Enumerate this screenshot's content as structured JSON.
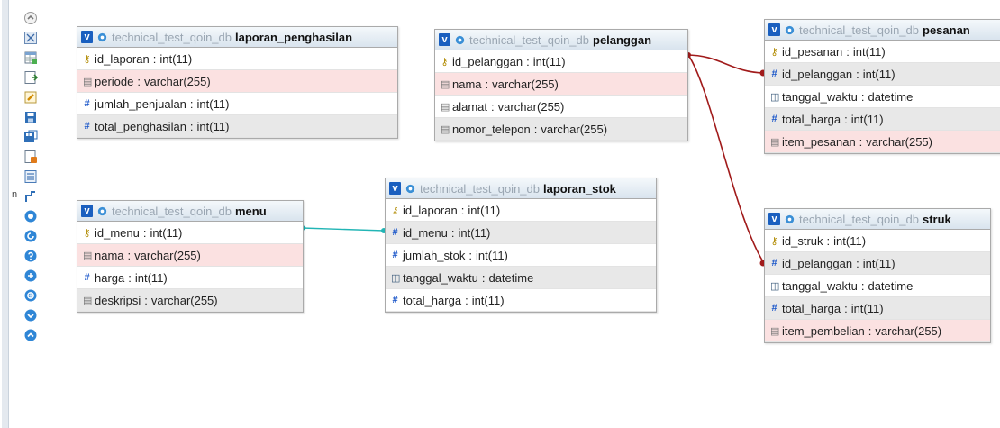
{
  "db_name": "technical_test_qoin_db",
  "edge_letter": "n",
  "toolbar": {
    "icons": [
      "collapse-icon",
      "fullscreen-icon",
      "add-table-icon",
      "import-icon",
      "edit-icon",
      "save-icon",
      "save-as-icon",
      "export-icon",
      "table-list-icon",
      "relation-icon",
      "circle-icon",
      "refresh-icon",
      "help-icon",
      "move-icon",
      "toggle-icon",
      "angle-down-icon",
      "angle-up-icon"
    ]
  },
  "tables": {
    "laporan_penghasilan": {
      "name": "laporan_penghasilan",
      "columns": [
        {
          "name": "id_laporan",
          "type": "int(11)"
        },
        {
          "name": "periode",
          "type": "varchar(255)"
        },
        {
          "name": "jumlah_penjualan",
          "type": "int(11)"
        },
        {
          "name": "total_penghasilan",
          "type": "int(11)"
        }
      ]
    },
    "pelanggan": {
      "name": "pelanggan",
      "columns": [
        {
          "name": "id_pelanggan",
          "type": "int(11)"
        },
        {
          "name": "nama",
          "type": "varchar(255)"
        },
        {
          "name": "alamat",
          "type": "varchar(255)"
        },
        {
          "name": "nomor_telepon",
          "type": "varchar(255)"
        }
      ]
    },
    "pesanan": {
      "name": "pesanan",
      "columns": [
        {
          "name": "id_pesanan",
          "type": "int(11)"
        },
        {
          "name": "id_pelanggan",
          "type": "int(11)"
        },
        {
          "name": "tanggal_waktu",
          "type": "datetime"
        },
        {
          "name": "total_harga",
          "type": "int(11)"
        },
        {
          "name": "item_pesanan",
          "type": "varchar(255)"
        }
      ]
    },
    "menu": {
      "name": "menu",
      "columns": [
        {
          "name": "id_menu",
          "type": "int(11)"
        },
        {
          "name": "nama",
          "type": "varchar(255)"
        },
        {
          "name": "harga",
          "type": "int(11)"
        },
        {
          "name": "deskripsi",
          "type": "varchar(255)"
        }
      ]
    },
    "laporan_stok": {
      "name": "laporan_stok",
      "columns": [
        {
          "name": "id_laporan",
          "type": "int(11)"
        },
        {
          "name": "id_menu",
          "type": "int(11)"
        },
        {
          "name": "jumlah_stok",
          "type": "int(11)"
        },
        {
          "name": "tanggal_waktu",
          "type": "datetime"
        },
        {
          "name": "total_harga",
          "type": "int(11)"
        }
      ]
    },
    "struk": {
      "name": "struk",
      "columns": [
        {
          "name": "id_struk",
          "type": "int(11)"
        },
        {
          "name": "id_pelanggan",
          "type": "int(11)"
        },
        {
          "name": "tanggal_waktu",
          "type": "datetime"
        },
        {
          "name": "total_harga",
          "type": "int(11)"
        },
        {
          "name": "item_pembelian",
          "type": "varchar(255)"
        }
      ]
    }
  },
  "colors": {
    "relation_fk": "#a11b1b",
    "relation_menu": "#22b5b5",
    "pk_highlight": "#fbe1e1"
  }
}
